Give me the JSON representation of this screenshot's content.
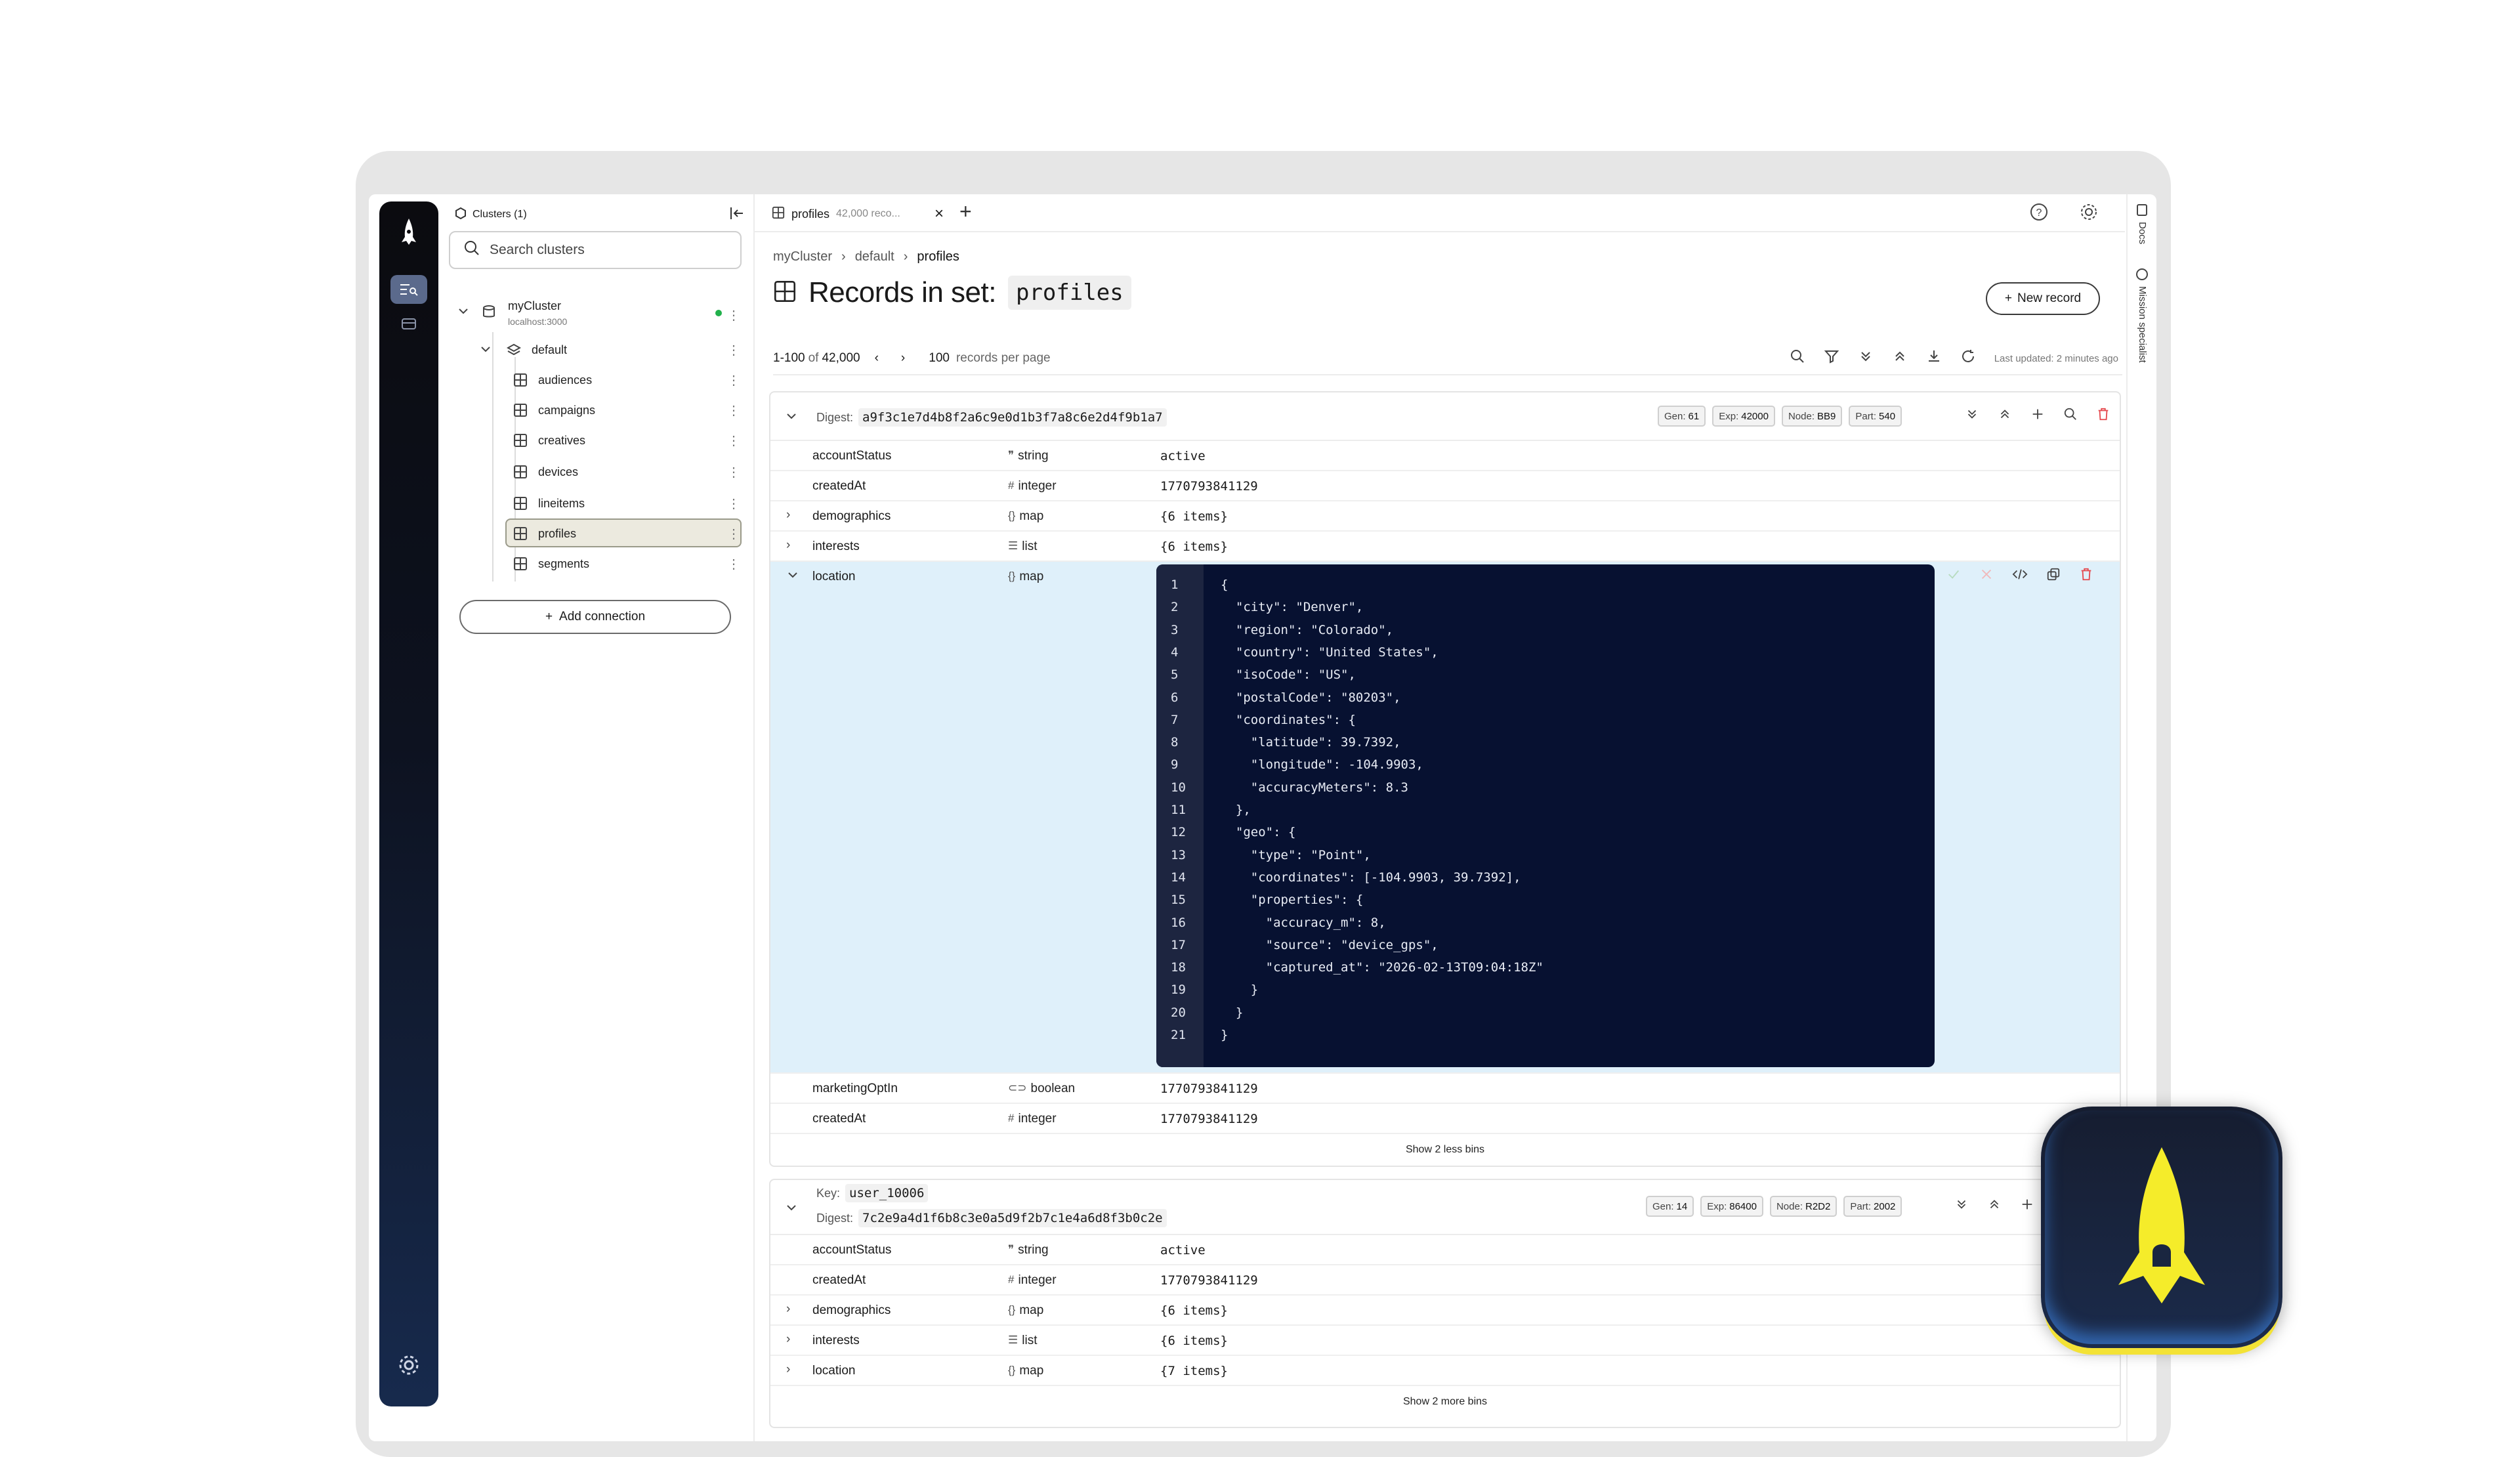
{
  "sidebar": {
    "header": "Clusters (1)",
    "search_placeholder": "Search clusters",
    "cluster": {
      "name": "myCluster",
      "host": "localhost:3000"
    },
    "namespace": "default",
    "sets": [
      "audiences",
      "campaigns",
      "creatives",
      "devices",
      "lineitems",
      "profiles",
      "segments"
    ],
    "selected_set": "profiles",
    "add_connection": "Add connection"
  },
  "tab": {
    "label": "profiles",
    "sub": "42,000 reco..."
  },
  "breadcrumb": {
    "cluster": "myCluster",
    "namespace": "default",
    "set": "profiles"
  },
  "title": {
    "prefix": "Records in set:",
    "set": "profiles"
  },
  "new_record": "New record",
  "pager": {
    "range": "1-100",
    "of": "of",
    "total": "42,000",
    "per_page": "100",
    "per_page_label": "records per page",
    "updated": "Last updated: 2 minutes ago"
  },
  "right_strip": {
    "docs": "Docs",
    "mission": "Mission specialist"
  },
  "record1": {
    "digest_label": "Digest:",
    "digest": "a9f3c1e7d4b8f2a6c9e0d1b3f7a8c6e2d4f9b1a7",
    "gen": "61",
    "exp": "42000",
    "node": "BB9",
    "part": "540",
    "bins": [
      {
        "name": "accountStatus",
        "type": "string",
        "icon": "quote-icon",
        "value": "active"
      },
      {
        "name": "createdAt",
        "type": "integer",
        "icon": "hash-icon",
        "value": "1770793841129"
      },
      {
        "name": "demographics",
        "type": "map",
        "icon": "braces-icon",
        "value": "{6 items}"
      },
      {
        "name": "interests",
        "type": "list",
        "icon": "list-icon",
        "value": "{6 items}"
      },
      {
        "name": "location",
        "type": "map",
        "icon": "braces-icon",
        "value": ""
      },
      {
        "name": "marketingOptIn",
        "type": "boolean",
        "icon": "toggle-icon",
        "value": "1770793841129"
      },
      {
        "name": "createdAt",
        "type": "integer",
        "icon": "hash-icon",
        "value": "1770793841129"
      }
    ],
    "show_toggle": "Show 2 less bins",
    "code_lines": [
      "{",
      "  \"city\": \"Denver\",",
      "  \"region\": \"Colorado\",",
      "  \"country\": \"United States\",",
      "  \"isoCode\": \"US\",",
      "  \"postalCode\": \"80203\",",
      "  \"coordinates\": {",
      "    \"latitude\": 39.7392,",
      "    \"longitude\": -104.9903,",
      "    \"accuracyMeters\": 8.3",
      "  },",
      "  \"geo\": {",
      "    \"type\": \"Point\",",
      "    \"coordinates\": [-104.9903, 39.7392],",
      "    \"properties\": {",
      "      \"accuracy_m\": 8,",
      "      \"source\": \"device_gps\",",
      "      \"captured_at\": \"2026-02-13T09:04:18Z\"",
      "    }",
      "  }",
      "}"
    ]
  },
  "record2": {
    "key_label": "Key:",
    "key": "user_10006",
    "digest_label": "Digest:",
    "digest": "7c2e9a4d1f6b8c3e0a5d9f2b7c1e4a6d8f3b0c2e",
    "gen": "14",
    "exp": "86400",
    "node": "R2D2",
    "part": "2002",
    "bins": [
      {
        "name": "accountStatus",
        "type": "string",
        "value": "active"
      },
      {
        "name": "createdAt",
        "type": "integer",
        "value": "1770793841129"
      },
      {
        "name": "demographics",
        "type": "map",
        "value": "{6 items}"
      },
      {
        "name": "interests",
        "type": "list",
        "value": "{6 items}"
      },
      {
        "name": "location",
        "type": "map",
        "value": "{7 items}"
      }
    ],
    "show_toggle": "Show 2 more bins"
  },
  "badge_labels": {
    "gen": "Gen:",
    "exp": "Exp:",
    "node": "Node:",
    "part": "Part:"
  },
  "colors": {
    "rail_top": "#0b0b0f",
    "rail_bottom": "#172a4d",
    "editor_bg": "#071131",
    "expanded_row": "#dff0fa",
    "accent_yellow": "#f3e236",
    "status_green": "#22b14c",
    "delete_red": "#e5484d"
  }
}
